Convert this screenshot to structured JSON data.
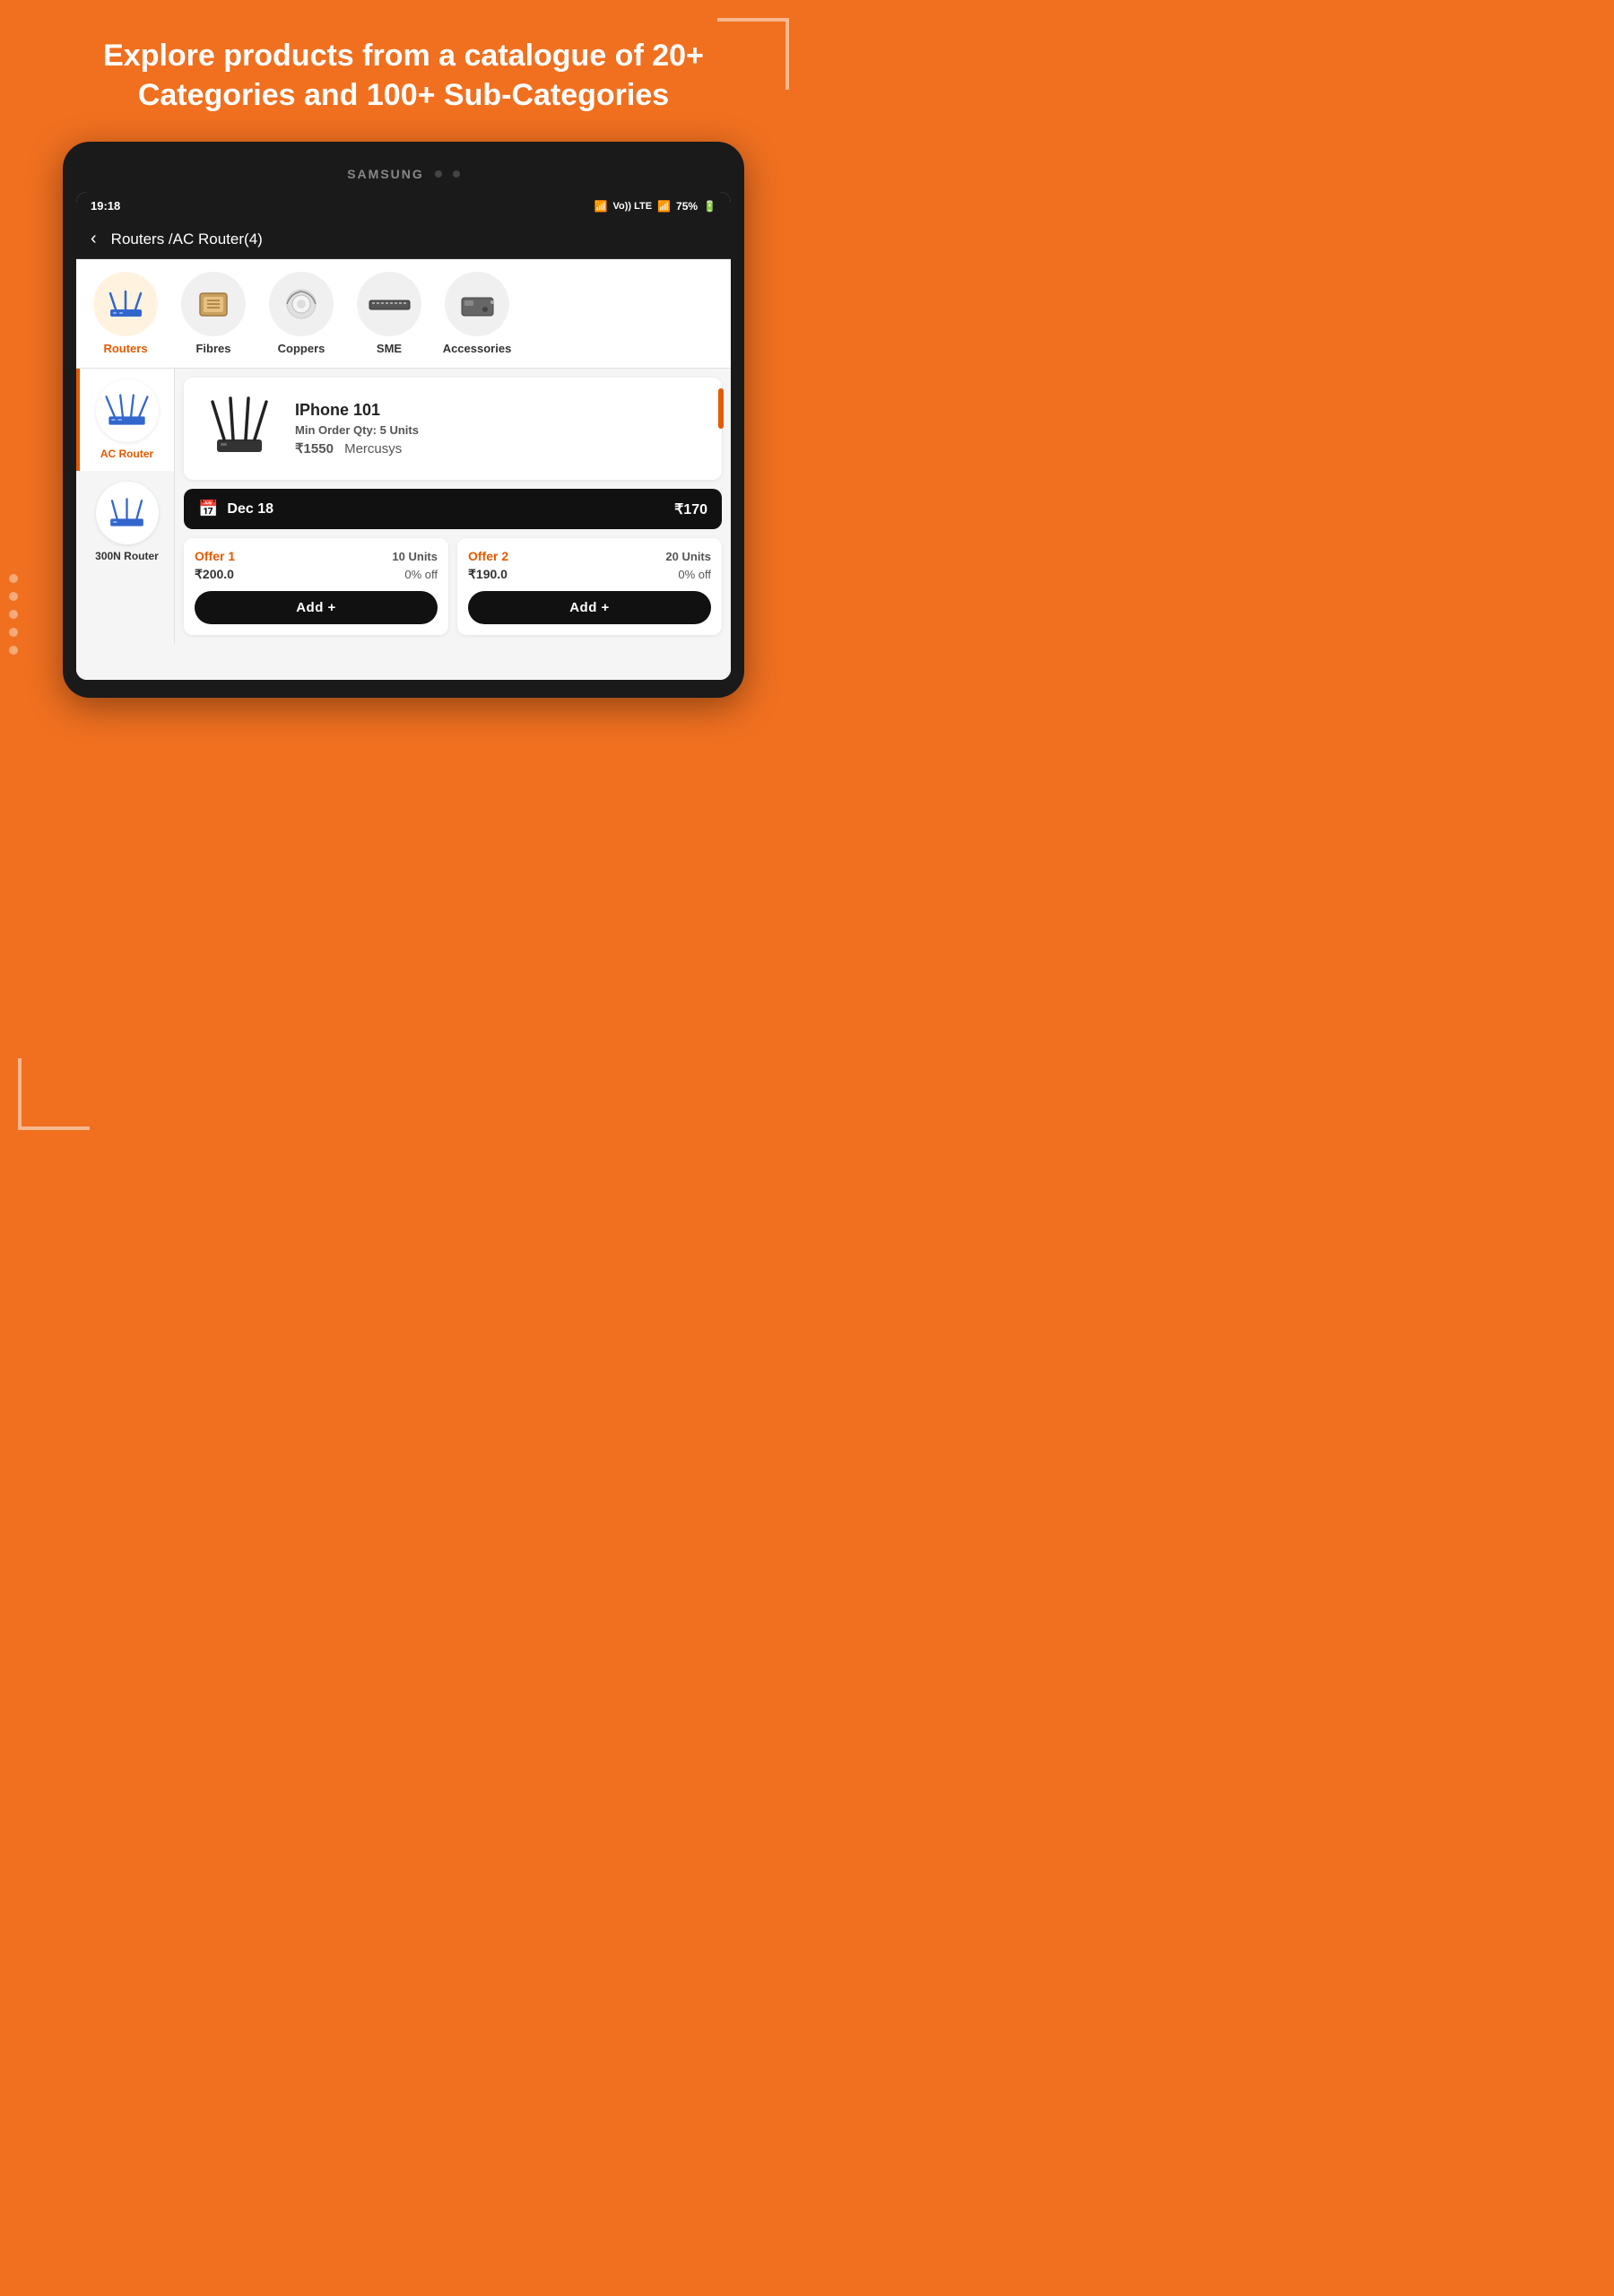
{
  "header": {
    "title": "Explore products from a catalogue of 20+ Categories and 100+ Sub-Categories"
  },
  "tablet": {
    "brand": "SAMSUNG"
  },
  "status_bar": {
    "time": "19:18",
    "battery": "75%",
    "signal_text": "Vo)) LTE"
  },
  "nav": {
    "back_label": "‹",
    "breadcrumb_main": "Routers",
    "breadcrumb_slash": " /",
    "breadcrumb_sub": "AC Router",
    "breadcrumb_count": "(4)"
  },
  "categories": [
    {
      "label": "Routers",
      "active": true
    },
    {
      "label": "Fibres",
      "active": false
    },
    {
      "label": "Coppers",
      "active": false
    },
    {
      "label": "SME",
      "active": false
    },
    {
      "label": "Accessories",
      "active": false
    }
  ],
  "sidebar": [
    {
      "label": "AC Router",
      "active": true
    },
    {
      "label": "300N Router",
      "active": false
    }
  ],
  "product": {
    "name": "IPhone 101",
    "min_order": "Min Order Qty: 5 Units",
    "price": "₹1550",
    "brand": "Mercusys"
  },
  "date_bar": {
    "date_label": "Dec 18",
    "price": "₹170"
  },
  "offers": [
    {
      "label": "Offer 1",
      "units": "10 Units",
      "price": "₹200.0",
      "discount": "0% off",
      "add_button": "Add +"
    },
    {
      "label": "Offer 2",
      "units": "20 Units",
      "price": "₹190.0",
      "discount": "0% off",
      "add_button": "Add +"
    }
  ],
  "colors": {
    "orange": "#F07020",
    "accent": "#E55A00",
    "dark": "#1a1a1a"
  }
}
